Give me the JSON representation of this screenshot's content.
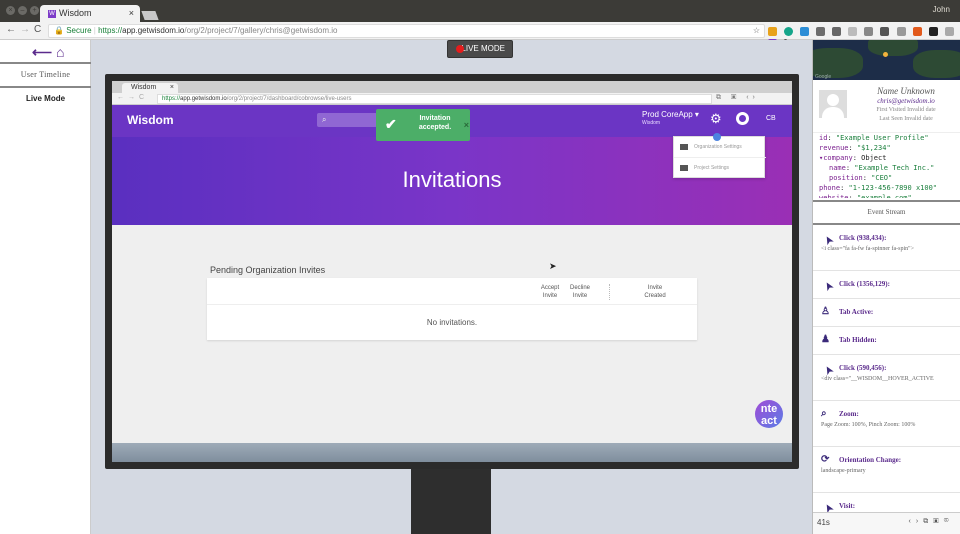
{
  "browser": {
    "tab_title": "Wisdom",
    "favicon_letter": "W",
    "user": "John",
    "secure_label": "Secure",
    "url_scheme": "https://",
    "url_host": "app.getwisdom.io",
    "url_path": "/org/2/project/7/gallery/chris@getwisdom.io",
    "colors": {
      "accent": "#6b35c4",
      "record": "#e51c1c"
    }
  },
  "left_panel": {
    "section_title": "User Timeline",
    "item": "Live Mode"
  },
  "live_button": {
    "label": "LIVE MODE"
  },
  "replay": {
    "tab_title": "Wisdom",
    "url_scheme": "https://",
    "url_host": "app.getwisdom.io",
    "url_path": "/org/2/project/7/dashboard/cobrowse/live-users",
    "app": {
      "brand": "Wisdom",
      "project_name": "Prod CoreApp ▾",
      "org_name": "Wisdom",
      "initials": "CB",
      "toast": "Invitation accepted.",
      "menu": [
        "Organization Settings",
        "Project Settings"
      ],
      "hero_title": "Invitations",
      "pending_title": "Pending Organization Invites",
      "columns": [
        "Accept Invite",
        "Decline Invite",
        "Invite Created"
      ],
      "empty": "No invitations.",
      "chat_bubble": "nte\nact"
    }
  },
  "profile": {
    "name": "Name Unknown",
    "email": "chris@getwisdom.io",
    "first_visited": "First Visited Invalid date",
    "last_seen": "Last Seen Invalid date",
    "json_lines": [
      {
        "indent": 0,
        "key": "id",
        "value": "\"Example User Profile\""
      },
      {
        "indent": 0,
        "key": "revenue",
        "value": "\"$1,234\""
      },
      {
        "indent": 0,
        "key": "▾company",
        "value": "Object",
        "object": true
      },
      {
        "indent": 1,
        "key": "name",
        "value": "\"Example Tech Inc.\""
      },
      {
        "indent": 1,
        "key": "position",
        "value": "\"CEO\""
      },
      {
        "indent": 0,
        "key": "phone",
        "value": "\"1-123-456-7890 x100\""
      },
      {
        "indent": 0,
        "key": "website",
        "value": "\"example.com\""
      }
    ]
  },
  "event_stream": {
    "title": "Event Stream",
    "events": [
      {
        "icon": "pointer",
        "title": "Click (938,434):",
        "detail": "<i class=\"fa fa-fw fa-spinner fa-spin\">"
      },
      {
        "icon": "pointer",
        "title": "Click (1356,129):",
        "detail": ""
      },
      {
        "icon": "user",
        "title": "Tab Active:",
        "detail": ""
      },
      {
        "icon": "user-x",
        "title": "Tab Hidden:",
        "detail": ""
      },
      {
        "icon": "pointer",
        "title": "Click (590,456):",
        "detail": "<div class=\"__WISDOM__HOVER_ACTIVE"
      },
      {
        "icon": "zoom",
        "title": "Zoom:",
        "detail": "Page Zoom: 100%, Pinch Zoom: 100%"
      },
      {
        "icon": "sync",
        "title": "Orientation Change:",
        "detail": "landscape-primary"
      },
      {
        "icon": "visit",
        "title": "Visit:",
        "detail": ""
      }
    ]
  },
  "footer": {
    "elapsed": "41s"
  }
}
